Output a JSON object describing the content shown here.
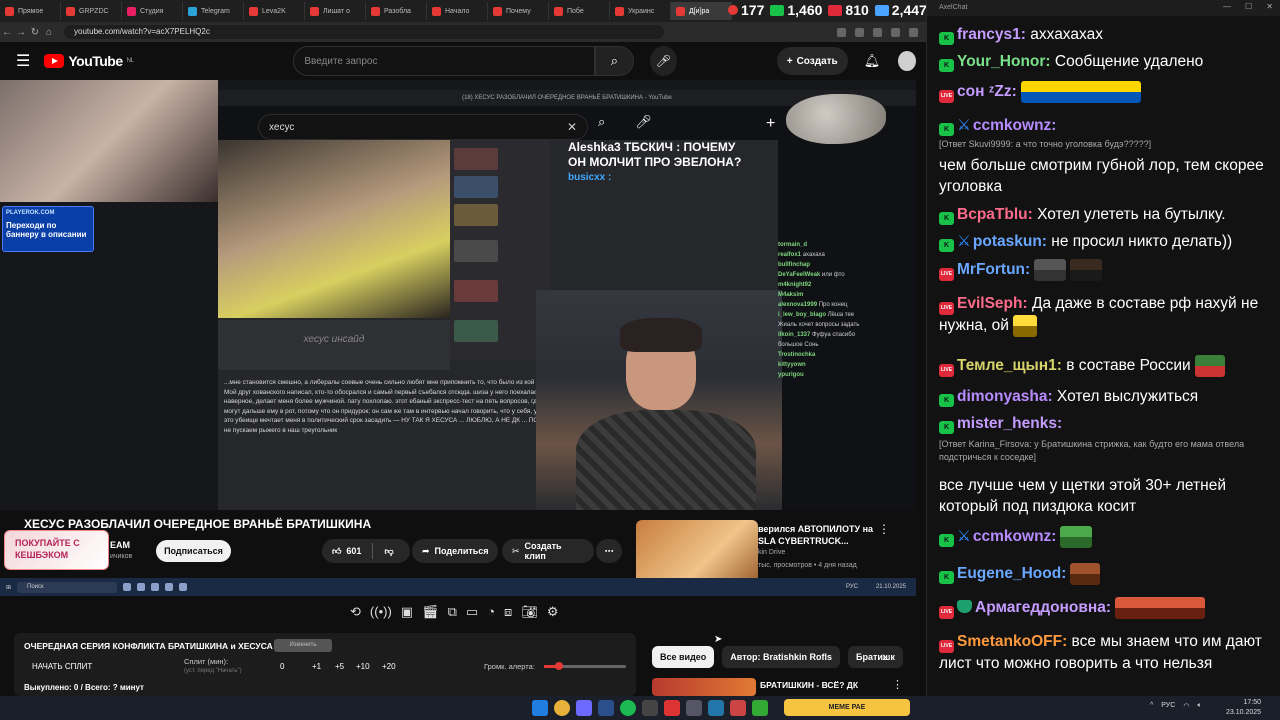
{
  "browser": {
    "tabs": [
      {
        "label": "Прямое"
      },
      {
        "label": "GRPZDC"
      },
      {
        "label": "Студия"
      },
      {
        "label": "Telegram"
      },
      {
        "label": "Leva2K"
      },
      {
        "label": "Лишат о"
      },
      {
        "label": "Разобла"
      },
      {
        "label": "Начало"
      },
      {
        "label": "Почему"
      },
      {
        "label": "Побе"
      },
      {
        "label": "Украинс"
      },
      {
        "label": "Д[и]ра"
      }
    ],
    "url": "youtube.com/watch?v=acX7PELHQ2c"
  },
  "stream_stats": [
    {
      "value": "177",
      "color": "#e53935"
    },
    {
      "value": "1,460",
      "color": "#18c248"
    },
    {
      "value": "810",
      "color": "#e02a3b"
    },
    {
      "value": "2,447",
      "color": "#4aa3ff"
    }
  ],
  "youtube": {
    "logo_text": "YouTube",
    "logo_region": "NL",
    "search_placeholder": "Введите запрос",
    "create_label": "Создать",
    "inner_window_title": "(18) ХЕСУС РАЗОБЛАЧИЛ ОЧЕРЕДНОЕ ВРАНЬЁ БРАТИШКИНА - YouTube",
    "inner_search_value": "хесус",
    "partner": {
      "site": "PLAYEROK.COM",
      "text": "Переходи по баннеру в описании"
    },
    "overlay": {
      "title": "Aleshka3 ТБСКИЧ : ПОЧЕМУ ОН МОЛЧИТ ПРО ЭВЕЛОНА?",
      "user": "busicxx :"
    },
    "inner_insight": "хесус инсайд",
    "inner_post": "...мне становится смешно, а либералы соевые очень сильно любят мне припомнить то, что было из кой типа – ноль дней без упоминаний хесуса. Мой друг хованского написал, кто-то обосрался и самый первый съебался отсюда. шиза у него поехалась. казу в глаза посмотрят, а не съебал, чем, наверное, делает меня более мужчиной. пату похлопаю. этот ебаный экспресс-тест на пять вопросов, где в конце он сказал \"словик\" (слова украин могут дальше ему в рот, потому что он придурок; он сам же там в интервью начал говорить, что у себя, у меня не было военных никаких проблем, это убеище мечтает меня в политический срок засадить — НУ ТАК Я ХЕСУСА ... ЛЮБЛЮ, А НЕ ДК ... ПОНИМАЕШЬ? это большая развал... ХАХ мне не пускаем рыжего в наш треугольник",
    "inner_chat": [
      {
        "user": "tormain_d",
        "text": ""
      },
      {
        "user": "realfox1",
        "text": "ахахаха"
      },
      {
        "user": "bullfinchap",
        "text": ""
      },
      {
        "user": "DeYaFeelWeak",
        "text": "или фто"
      },
      {
        "user": "m4knight92",
        "text": ""
      },
      {
        "user": "M4aksim",
        "text": ""
      },
      {
        "user": "alexnova1999",
        "text": "Про конец"
      },
      {
        "user": "i_lew_boy_blago",
        "text": "Лёша тее"
      },
      {
        "user": "",
        "text": "Жиаль хочет вопросы задать"
      },
      {
        "user": "lIkoin_1337",
        "text": "Фуфуа спасибо"
      },
      {
        "user": "",
        "text": "большое Сонь"
      },
      {
        "user": "Trostinochka",
        "text": ""
      },
      {
        "user": "kittyyown",
        "text": ""
      },
      {
        "user": "ypurigou",
        "text": ""
      }
    ],
    "video_title": "ХЕСУС РАЗОБЛАЧИЛ ОЧЕРЕДНОЕ ВРАНЬЁ БРАТИШКИНА",
    "cashback": "ПОКУПАЙТЕ С КЕШБЭКОМ",
    "channel_suffix": "EAM",
    "subscribers_suffix": "ичиков",
    "subscribe_label": "Подписаться",
    "likes": "601",
    "share_label": "Поделиться",
    "clip_label": "Создать клип",
    "related": {
      "title": "верился АВТОПИЛОТУ на SLA CYBERTRUCK...",
      "channel": "kin Drive",
      "meta": "тыс. просмотров • 4 дня назад"
    },
    "inner_taskbar": {
      "search": "Поиск",
      "tray": "РУС",
      "time": "21.10.2025"
    },
    "split": {
      "title": "ОЧЕРЕДНАЯ СЕРИЯ КОНФЛИКТА БРАТИШКИНА и ХЕСУСА",
      "badge": "Изменить",
      "start_label": "НАЧАТЬ СПЛИТ",
      "minutes_label": "Сплит (мин):",
      "minutes_hint": "(уст. перед \"Начать\")",
      "minutes_value": "0",
      "buttons": [
        "+1",
        "+5",
        "+10",
        "+20"
      ],
      "alert_label": "Громк. алерта:",
      "alert_volume": 0.18,
      "done": "Выкуплено: 0 / Всего: ? минут"
    },
    "filters": [
      "Все видео",
      "Автор: Bratishkin Rofls",
      "Братишк"
    ],
    "next_video": "БРАТИШКИН - ВСЁ? ДК"
  },
  "taskbar": {
    "meme": "МЕМЕ РАЕ",
    "tray_lang": "РУС",
    "time": "17:50",
    "date": "23.10.2025"
  },
  "chat": {
    "window_title": "AxelChat",
    "messages": [
      {
        "src": "kick",
        "user": "francys1:",
        "user_color": "#c59cff",
        "text": " аххахахах"
      },
      {
        "src": "kick",
        "user": "Your_Honor:",
        "user_color": "#7be08a",
        "text": " Сообщение удалено"
      },
      {
        "src": "live",
        "user": "сон ᶻZz:",
        "user_color": "#c59cff",
        "text": ""
      },
      {
        "src": "kick",
        "user": "ccmkownz:",
        "user_color": "#b78cff",
        "text": "",
        "prefix": "sword"
      },
      {
        "src": "reply",
        "user": "",
        "text": "[Ответ Skuvi9999: а что точно уголовка будэ?????]"
      },
      {
        "src": "none",
        "user": "",
        "text": "чем больше смотрим губной лор, тем скорее уголовка"
      },
      {
        "src": "kick",
        "user": "BcpaTblu:",
        "user_color": "#ff6b8a",
        "text": " Хотел улететь на бутылку."
      },
      {
        "src": "kick",
        "user": "potaskun:",
        "user_color": "#6aa7ff",
        "text": " не просил никто делать))",
        "prefix": "sword"
      },
      {
        "src": "live",
        "user": "MrFortun:",
        "user_color": "#6aa7ff",
        "text": ""
      },
      {
        "src": "live",
        "user": "EvilSeph:",
        "user_color": "#ff6b8a",
        "text": " Да даже в составе рф нахуй не нужна, ой"
      },
      {
        "src": "live",
        "user": "Темле_щын1:",
        "user_color": "#d6d36b",
        "text": " в составе России"
      },
      {
        "src": "kick",
        "user": "dimonyasha:",
        "user_color": "#b78cff",
        "text": " Хотел выслужиться"
      },
      {
        "src": "kick",
        "user": "mister_henks:",
        "user_color": "#c59cff",
        "text": ""
      },
      {
        "src": "reply",
        "user": "",
        "text": "[Ответ Karina_Firsova: у Братишкина стрижка, как будто его мама отвела подстричься к соседке]"
      },
      {
        "src": "none",
        "user": "",
        "text": "все лучше чем у щетки этой 30+ летней который под пиздюка косит"
      },
      {
        "src": "kick",
        "user": "ccmkownz:",
        "user_color": "#b78cff",
        "text": "",
        "prefix": "sword"
      },
      {
        "src": "kick",
        "user": "Eugene_Hood:",
        "user_color": "#6aa7ff",
        "text": ""
      },
      {
        "src": "live",
        "user": "Армагеддоновна:",
        "user_color": "#c59cff",
        "text": "",
        "prefix": "shield"
      },
      {
        "src": "live",
        "user": "SmetankoOFF:",
        "user_color": "#ff9a3c",
        "text": " все мы знаем что им дают лист что можно говорить а что нельзя"
      }
    ]
  }
}
